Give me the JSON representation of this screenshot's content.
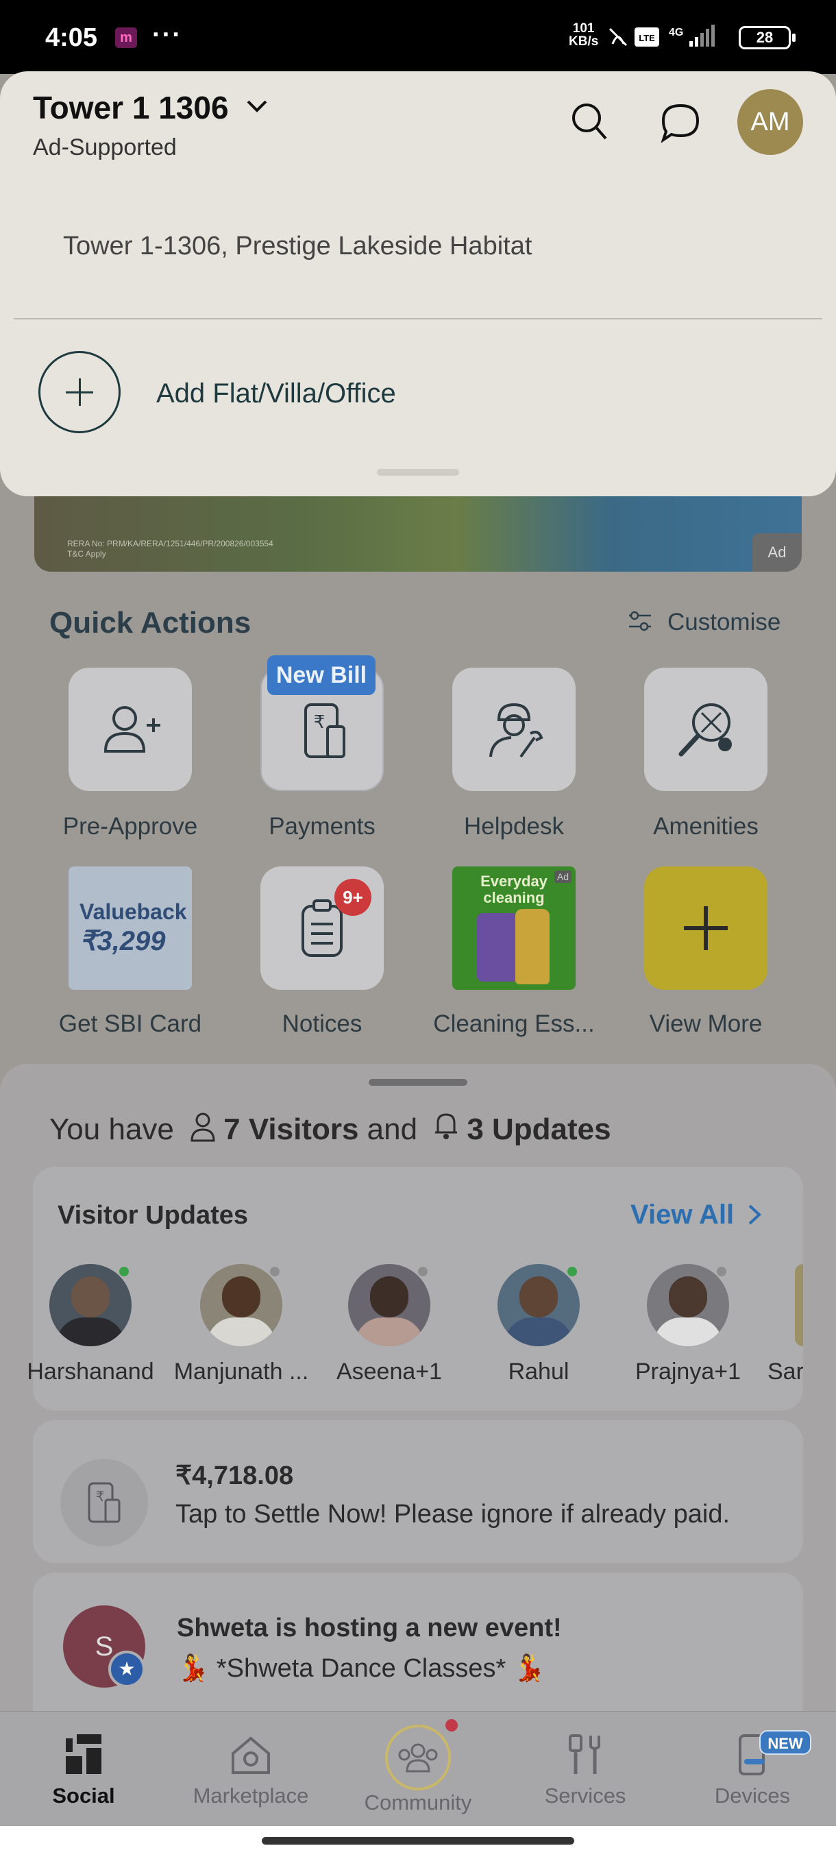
{
  "status_bar": {
    "time": "4:05",
    "app_icon": "m",
    "more": "···",
    "net_speed": "101",
    "net_unit": "KB/s",
    "network": "Vo LTE 4G",
    "battery": "28"
  },
  "header": {
    "title": "Tower 1 1306",
    "subtitle": "Ad-Supported",
    "avatar_initials": "AM"
  },
  "flat_selector": {
    "selected_flat": "Tower 1-1306, Prestige Lakeside Habitat",
    "add_label": "Add Flat/Villa/Office"
  },
  "banner": {
    "ad_label": "Ad",
    "legal_text": "RERA No: PRM/KA/RERA/1251/446/PR/200826/003554\nT&C Apply"
  },
  "quick_actions": {
    "title": "Quick Actions",
    "customise": "Customise",
    "new_bill_badge": "New Bill",
    "notices_badge": "9+",
    "items": [
      {
        "label": "Pre-Approve",
        "icon": "add-person-icon"
      },
      {
        "label": "Payments",
        "icon": "bill-phone-icon"
      },
      {
        "label": "Helpdesk",
        "icon": "technician-icon"
      },
      {
        "label": "Amenities",
        "icon": "racket-icon"
      },
      {
        "label": "Get SBI Card",
        "icon": "sbi-card-ad"
      },
      {
        "label": "Notices",
        "icon": "clipboard-icon"
      },
      {
        "label": "Cleaning Ess...",
        "icon": "cleaning-ad"
      },
      {
        "label": "View More",
        "icon": "plus-icon"
      }
    ],
    "sbi_tile": {
      "line1": "Valueback",
      "line2": "₹3,299"
    },
    "cleaning_tile": {
      "text": "Everyday cleaning",
      "ad": "Ad"
    }
  },
  "summary": {
    "prefix": "You have",
    "visitors": "7 Visitors",
    "and": "and",
    "updates": "3 Updates"
  },
  "visitor_updates": {
    "title": "Visitor Updates",
    "view_all": "View All",
    "visitors": [
      {
        "name": "Harshanand",
        "status_color": "#3aa14a"
      },
      {
        "name": "Manjunath ...",
        "status_color": "#8d8d8d"
      },
      {
        "name": "Aseena+1",
        "status_color": "#8d8d8d"
      },
      {
        "name": "Rahul",
        "status_color": "#3aa14a"
      },
      {
        "name": "Prajnya+1",
        "status_color": "#8d8d8d"
      },
      {
        "name": "Sar",
        "status_color": "#8d8d8d"
      }
    ]
  },
  "payment_card": {
    "amount": "₹4,718.08",
    "message": "Tap to Settle Now! Please ignore if already paid."
  },
  "event_card": {
    "avatar_letter": "S",
    "title": "Shweta is hosting a new event!",
    "subtitle": "💃 *Shweta Dance Classes* 💃"
  },
  "bottom_nav": {
    "items": [
      {
        "label": "Social",
        "icon": "social-icon",
        "active": true
      },
      {
        "label": "Marketplace",
        "icon": "marketplace-icon",
        "active": false
      },
      {
        "label": "Community",
        "icon": "community-icon",
        "active": false
      },
      {
        "label": "Services",
        "icon": "services-icon",
        "active": false
      },
      {
        "label": "Devices",
        "icon": "devices-icon",
        "active": false
      }
    ],
    "devices_badge": "NEW"
  },
  "colors": {
    "accent_blue": "#2b6fb1",
    "new_bill_blue": "#3b78c8",
    "badge_red": "#cc3a3c",
    "view_more_yellow": "#b9a82a",
    "avatar_olive": "#9d8a50"
  }
}
